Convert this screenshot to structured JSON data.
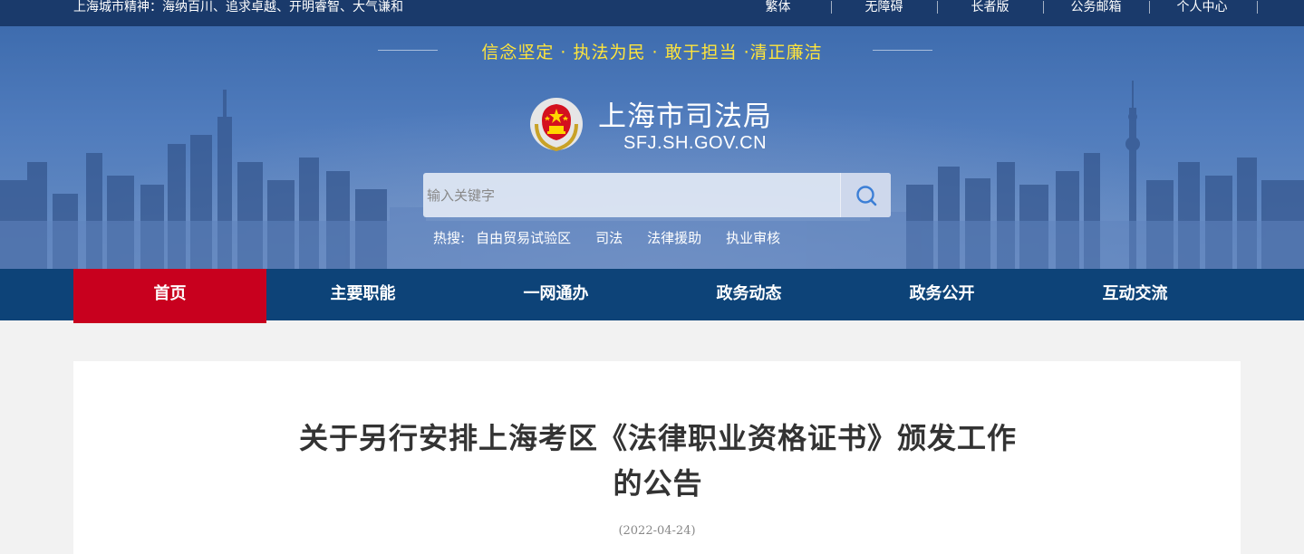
{
  "topbar": {
    "spirit": "上海城市精神：海纳百川、追求卓越、开明睿智、大气谦和",
    "links": [
      "繁体",
      "无障碍",
      "长者版",
      "公务邮箱",
      "个人中心"
    ]
  },
  "banner": {
    "motto": "信念坚定 · 执法为民 · 敢于担当 ·清正廉洁",
    "site_title": "上海市司法局",
    "site_domain": "SFJ.SH.GOV.CN",
    "search_placeholder": "输入关键字",
    "hot_label": "热搜:",
    "hot_links": [
      "自由贸易试验区",
      "司法",
      "法律援助",
      "执业审核"
    ]
  },
  "nav": {
    "items": [
      "首页",
      "主要职能",
      "一网通办",
      "政务动态",
      "政务公开",
      "互动交流"
    ],
    "active_index": 0
  },
  "article": {
    "title": "关于另行安排上海考区《法律职业资格证书》颁发工作的公告",
    "date": "(2022-04-24)"
  },
  "colors": {
    "topbar": "#1a3a6b",
    "nav": "#0d4378",
    "nav_active": "#c8001e",
    "motto": "#ffe53b"
  },
  "icons": {
    "search": "search-icon",
    "emblem": "court-emblem-icon"
  }
}
